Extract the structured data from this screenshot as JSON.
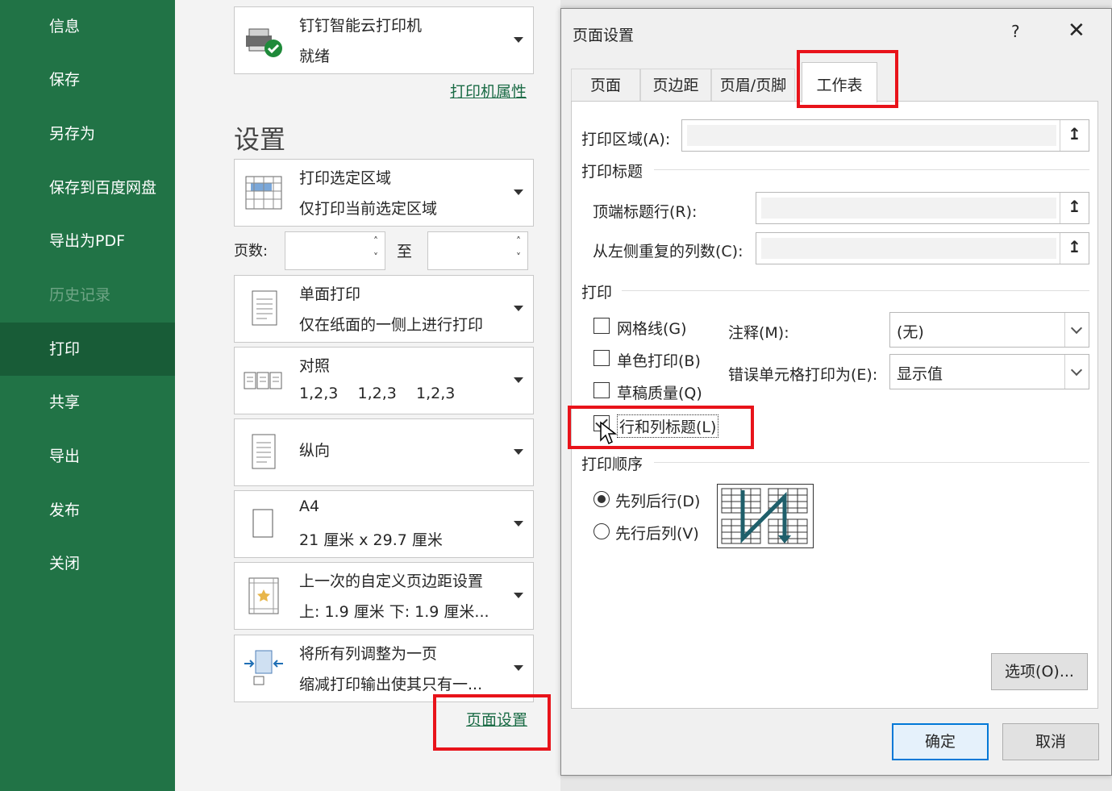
{
  "nav": {
    "items": [
      {
        "label": "信息"
      },
      {
        "label": "保存"
      },
      {
        "label": "另存为"
      },
      {
        "label": "保存到百度网盘"
      },
      {
        "label": "导出为PDF"
      },
      {
        "label": "历史记录"
      },
      {
        "label": "打印"
      },
      {
        "label": "共享"
      },
      {
        "label": "导出"
      },
      {
        "label": "发布"
      },
      {
        "label": "关闭"
      }
    ]
  },
  "printer": {
    "name": "钉钉智能云打印机",
    "status": "就绪",
    "properties_link": "打印机属性"
  },
  "settings": {
    "title": "设置",
    "print_area": {
      "line1": "打印选定区域",
      "line2": "仅打印当前选定区域"
    },
    "pages_label": "页数:",
    "to_label": "至",
    "sides": {
      "line1": "单面打印",
      "line2": "仅在纸面的一侧上进行打印"
    },
    "collate": {
      "line1": "对照",
      "line2": "1,2,3    1,2,3    1,2,3"
    },
    "orientation": {
      "line1": "纵向"
    },
    "paper": {
      "line1": "A4",
      "line2": "21 厘米 x 29.7 厘米"
    },
    "margins": {
      "line1": "上一次的自定义页边距设置",
      "line2": "上: 1.9 厘米 下: 1.9 厘米..."
    },
    "scaling": {
      "line1": "将所有列调整为一页",
      "line2": "缩减打印输出使其只有一..."
    },
    "page_setup_link": "页面设置"
  },
  "dialog": {
    "title": "页面设置",
    "help": "?",
    "close": "✕",
    "tabs": [
      "页面",
      "页边距",
      "页眉/页脚",
      "工作表"
    ],
    "print_area_label": "打印区域(A):",
    "print_titles_section": "打印标题",
    "top_rows_label": "顶端标题行(R):",
    "left_cols_label": "从左侧重复的列数(C):",
    "print_section": "打印",
    "gridlines": "网格线(G)",
    "mono": "单色打印(B)",
    "draft": "草稿质量(Q)",
    "row_col_headings": "行和列标题(L)",
    "comments_label": "注释(M):",
    "comments_value": "(无)",
    "errors_label": "错误单元格打印为(E):",
    "errors_value": "显示值",
    "order_section": "打印顺序",
    "down_then_over": "先列后行(D)",
    "over_then_down": "先行后列(V)",
    "options_button": "选项(O)...",
    "ok_button": "确定",
    "cancel_button": "取消",
    "ref_icon": "↥"
  }
}
